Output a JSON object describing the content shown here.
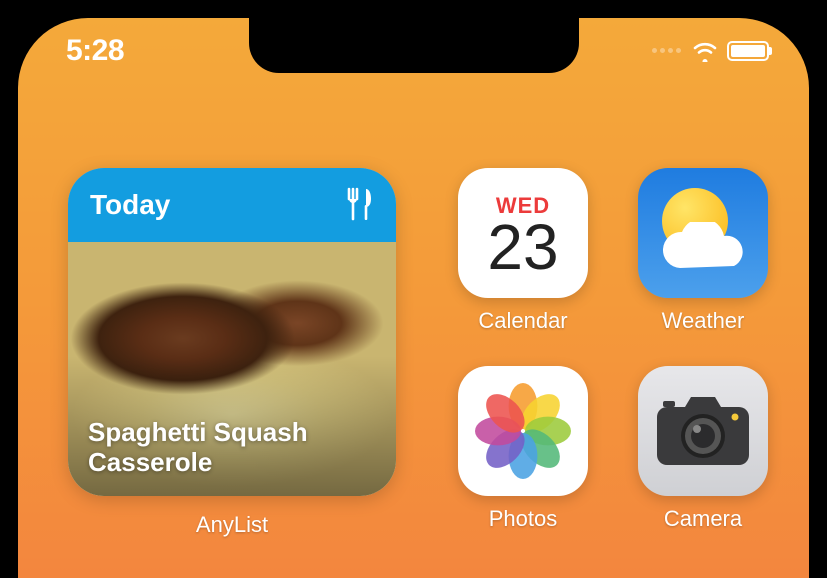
{
  "status": {
    "time": "5:28"
  },
  "widget": {
    "header": "Today",
    "recipe": "Spaghetti Squash Casserole",
    "label": "AnyList"
  },
  "apps": {
    "calendar": {
      "label": "Calendar",
      "weekday": "WED",
      "date": "23"
    },
    "weather": {
      "label": "Weather"
    },
    "photos": {
      "label": "Photos"
    },
    "camera": {
      "label": "Camera"
    }
  }
}
